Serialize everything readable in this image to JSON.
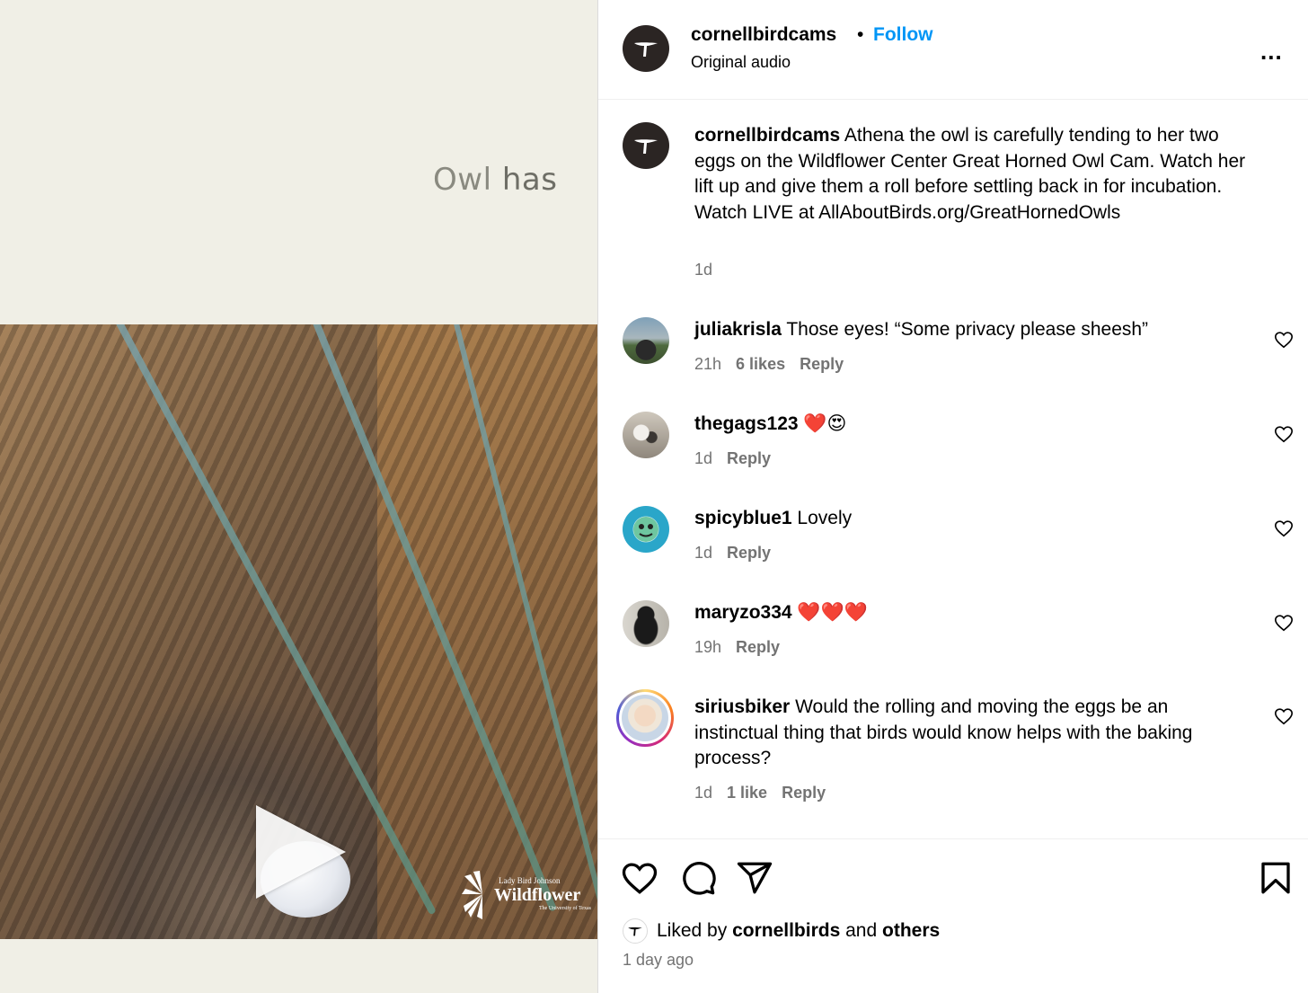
{
  "media": {
    "overlay_text_light": "Owl",
    "overlay_text_bold": "has",
    "watermark": {
      "line1": "Lady Bird Johnson",
      "line2": "Wildflower",
      "line3": "The University of Texas"
    }
  },
  "header": {
    "username": "cornellbirdcams",
    "separator": "•",
    "follow_label": "Follow",
    "subtitle": "Original audio",
    "more_label": "..."
  },
  "caption": {
    "username": "cornellbirdcams",
    "text": "Athena the owl is carefully tending to her two eggs on the Wildflower Center Great Horned Owl Cam. Watch her lift up and give them a roll before settling back in for incubation. Watch LIVE at AllAboutBirds.org/GreatHornedOwls",
    "time": "1d"
  },
  "comments": [
    {
      "username": "juliakrisla",
      "text": "Those eyes! “Some privacy please sheesh”",
      "time": "21h",
      "likes": "6 likes",
      "reply": "Reply"
    },
    {
      "username": "thegags123",
      "text": "❤️😍",
      "time": "1d",
      "likes": "",
      "reply": "Reply"
    },
    {
      "username": "spicyblue1",
      "text": "Lovely",
      "time": "1d",
      "likes": "",
      "reply": "Reply"
    },
    {
      "username": "maryzo334",
      "text": "❤️❤️❤️",
      "time": "19h",
      "likes": "",
      "reply": "Reply"
    },
    {
      "username": "siriusbiker",
      "text": "Would the rolling and moving the eggs be an instinctual thing that birds would know helps with the baking process?",
      "time": "1d",
      "likes": "1 like",
      "reply": "Reply"
    }
  ],
  "footer": {
    "liked_by_prefix": "Liked by",
    "liked_by_user": "cornellbirds",
    "liked_by_and": "and",
    "liked_by_others": "others",
    "time_ago": "1 day ago"
  },
  "icons": [
    "bird-logo-icon",
    "more-icon",
    "heart-icon",
    "comment-icon",
    "share-icon",
    "bookmark-icon",
    "play-icon"
  ],
  "colors": {
    "accent": "#0095f6",
    "meta": "#737373",
    "heart_red": "#ff3040"
  }
}
